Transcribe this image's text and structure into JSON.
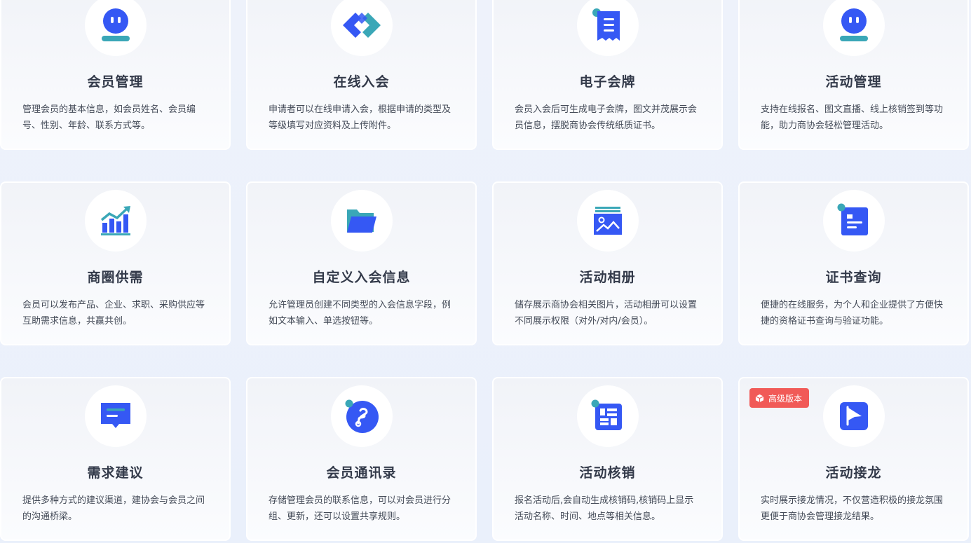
{
  "colors": {
    "primary": "#3558f4",
    "teal": "#3aa7b7",
    "badge": "#f15a57"
  },
  "cards": [
    {
      "title": "会员管理",
      "desc": "管理会员的基本信息，如会员姓名、会员编号、性别、年龄、联系方式等。",
      "icon": "member-face-icon"
    },
    {
      "title": "在线入会",
      "desc": "申请者可以在线申请入会，根据申请的类型及等级填写对应资料及上传附件。",
      "icon": "link-chain-icon"
    },
    {
      "title": "电子会牌",
      "desc": "会员入会后可生成电子会牌，图文并茂展示会员信息，摆脱商协会传统纸质证书。",
      "icon": "receipt-icon"
    },
    {
      "title": "活动管理",
      "desc": "支持在线报名、图文直播、线上核销签到等功能，助力商协会轻松管理活动。",
      "icon": "activity-face-icon"
    },
    {
      "title": "商圈供需",
      "desc": "会员可以发布产品、企业、求职、采购供应等互助需求信息，共赢共创。",
      "icon": "growth-chart-icon"
    },
    {
      "title": "自定义入会信息",
      "desc": "允许管理员创建不同类型的入会信息字段，例如文本输入、单选按钮等。",
      "icon": "folder-icon"
    },
    {
      "title": "活动相册",
      "desc": "储存展示商协会相关图片，活动相册可以设置不同展示权限（对外/对内/会员）。",
      "icon": "photo-album-icon"
    },
    {
      "title": "证书查询",
      "desc": "便捷的在线服务，为个人和企业提供了方便快捷的资格证书查询与验证功能。",
      "icon": "certificate-icon"
    },
    {
      "title": "需求建议",
      "desc": "提供多种方式的建议渠道，建协会与会员之间的沟通桥梁。",
      "icon": "message-icon"
    },
    {
      "title": "会员通讯录",
      "desc": "存储管理会员的联系信息，可以对会员进行分组、更新，还可以设置共享规则。",
      "icon": "contacts-icon"
    },
    {
      "title": "活动核销",
      "desc": "报名活动后,会自动生成核销码,核销码上显示活动名称、时间、地点等相关信息。",
      "icon": "verify-code-icon"
    },
    {
      "title": "活动接龙",
      "desc": "实时展示接龙情况，不仅营造积极的接龙氛围更便于商协会管理接龙结果。",
      "icon": "flag-icon",
      "badge": "高级版本"
    }
  ]
}
